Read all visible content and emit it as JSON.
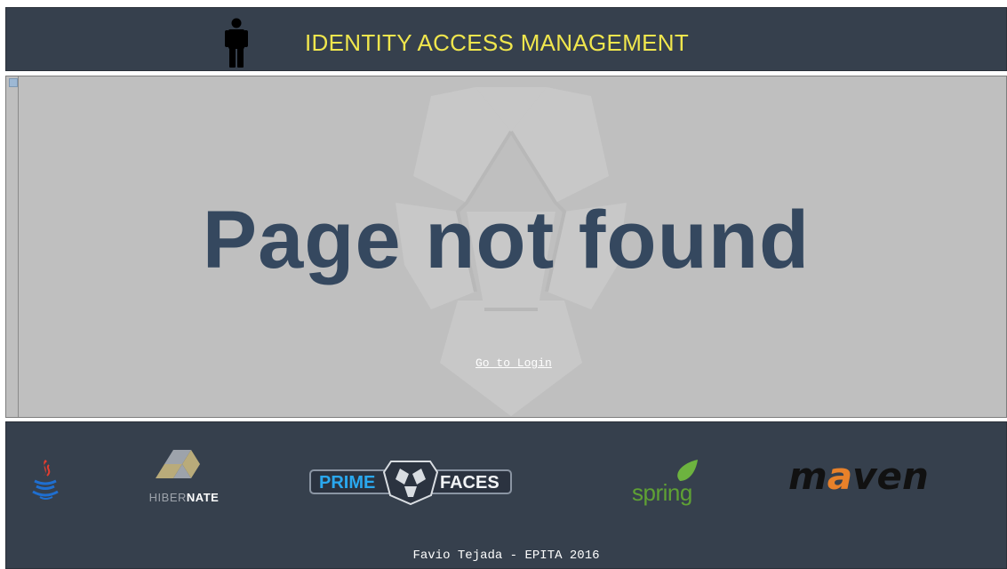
{
  "header": {
    "title": "IDENTITY ACCESS MANAGEMENT",
    "icon": "person-icon",
    "title_color": "#f0e64d",
    "background": "#36404d"
  },
  "main": {
    "heading": "Page not found",
    "link_label": "Go to Login",
    "background_logo": "primefaces-mask-watermark",
    "heading_color": "#35485f",
    "background": "#bfbfbf"
  },
  "footer": {
    "logos": [
      {
        "name": "java-logo"
      },
      {
        "name": "hibernate-logo",
        "text_light": "HIBER",
        "text_bold": "NATE"
      },
      {
        "name": "primefaces-logo",
        "text_left": "PRIME",
        "text_right": "FACES"
      },
      {
        "name": "spring-logo",
        "text": "spring"
      },
      {
        "name": "maven-logo",
        "text_accent": "m",
        "text_accent2": "a",
        "text_rest": "ven"
      }
    ],
    "copyright": "Favio Tejada - EPITA 2016",
    "background": "#36404d"
  }
}
